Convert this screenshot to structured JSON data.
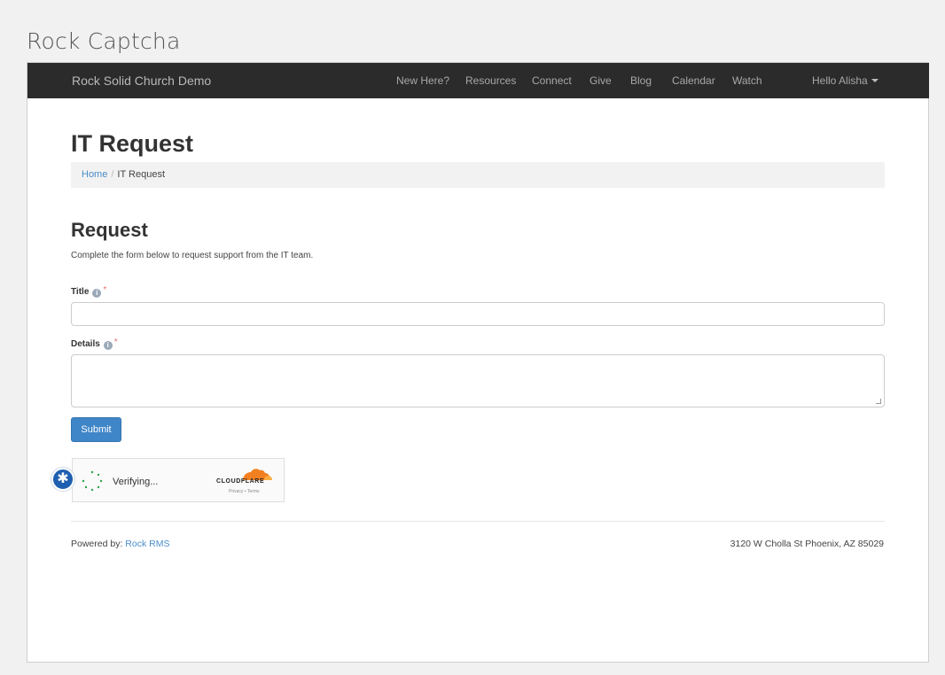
{
  "document_title": "Rock Captcha",
  "navbar": {
    "brand": "Rock Solid Church Demo",
    "links": [
      "New Here?",
      "Resources",
      "Connect",
      "Give",
      "Blog",
      "Calendar",
      "Watch"
    ],
    "user_menu": "Hello Alisha"
  },
  "page": {
    "title": "IT Request",
    "breadcrumb": {
      "home": "Home",
      "separator": "/",
      "current": "IT Request"
    }
  },
  "form": {
    "section_title": "Request",
    "description": "Complete the form below to request support from the IT team.",
    "fields": [
      {
        "label": "Title",
        "required_mark": "*",
        "value": ""
      },
      {
        "label": "Details",
        "required_mark": "*",
        "value": ""
      }
    ],
    "submit_label": "Submit"
  },
  "captcha": {
    "status": "Verifying...",
    "provider": "CLOUDFLARE",
    "privacy": "Privacy",
    "terms": "Terms",
    "link_sep": "•"
  },
  "footer": {
    "powered_prefix": "Powered by:",
    "powered_link": "Rock RMS",
    "address": "3120 W Cholla St Phoenix, AZ 85029"
  },
  "colors": {
    "navbar_bg": "#2b2b2b",
    "primary_button": "#3f86c8",
    "link": "#4a8dc8",
    "cloudflare_orange": "#f38020",
    "badge_blue": "#1e5fb0"
  },
  "icons": [
    "info-icon",
    "spinner-icon",
    "cloudflare-logo-icon",
    "asterisk-badge-icon",
    "caret-down-icon"
  ]
}
